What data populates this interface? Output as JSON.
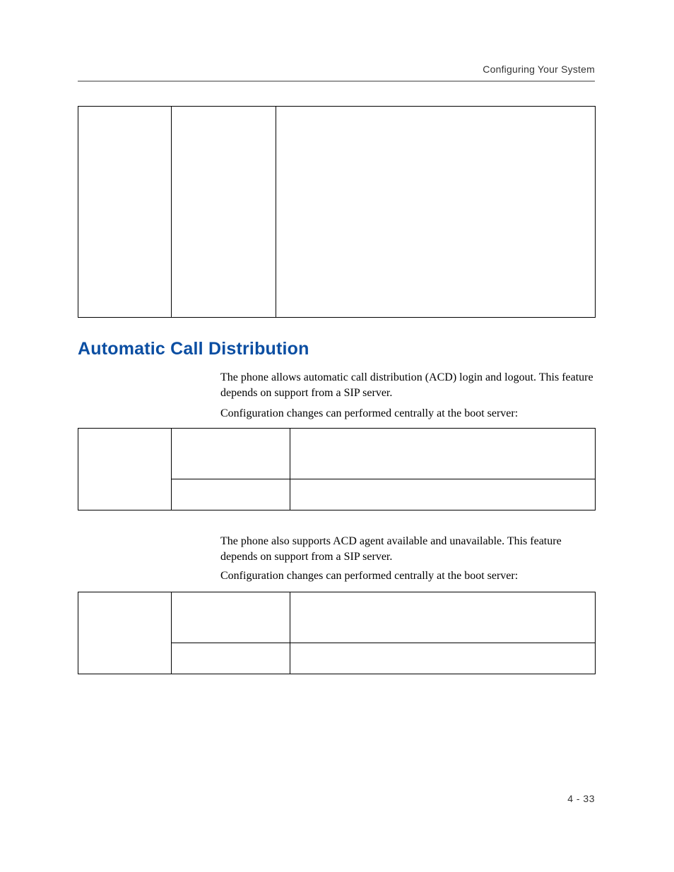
{
  "header": {
    "running": "Configuring Your System"
  },
  "section": {
    "title": "Automatic Call Distribution"
  },
  "paragraphs": {
    "p1": "The phone allows automatic call distribution (ACD) login and logout. This feature depends on support from a SIP server.",
    "p2": "Configuration changes can performed centrally at the boot server:",
    "p3": "The phone also supports ACD agent available and unavailable. This feature depends on support from a SIP server.",
    "p4": "Configuration changes can performed centrally at the boot server:"
  },
  "table1": {
    "rows": [
      {
        "c1": "",
        "c2": "",
        "c3": ""
      }
    ]
  },
  "table2": {
    "rows": [
      {
        "c1": "",
        "c2": "",
        "c3": ""
      },
      {
        "c1": "",
        "c2": "",
        "c3": ""
      }
    ]
  },
  "table3": {
    "rows": [
      {
        "c1": "",
        "c2": "",
        "c3": ""
      },
      {
        "c1": "",
        "c2": "",
        "c3": ""
      }
    ]
  },
  "footer": {
    "pagenum": "4 - 33"
  }
}
